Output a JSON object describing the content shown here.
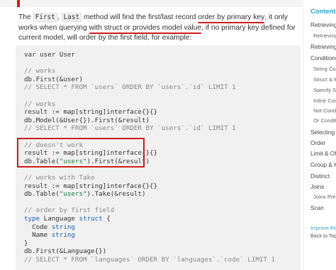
{
  "paragraph": {
    "intro": "The ",
    "code1": "First",
    "sep": ", ",
    "code2": "Last",
    "t1": " method will find the first/last record ",
    "u1": "order by primary key",
    "t2": ", it only works when querying ",
    "u2": "with struct or provides model value",
    "t3": ", if no primary key defined for current model, will order by the first field, for example:"
  },
  "code_lines": [
    {
      "text": "var user User",
      "cls": ""
    },
    {
      "text": "",
      "cls": ""
    },
    {
      "text": "// works",
      "cls": "c"
    },
    {
      "text": "db.First(&user)",
      "cls": ""
    },
    {
      "text": "// SELECT * FROM `users` ORDER BY `users`.`id` LIMIT 1",
      "cls": "c"
    },
    {
      "text": "",
      "cls": ""
    },
    {
      "text": "// works",
      "cls": "c"
    },
    {
      "text": "result := map[string]interface{}{}",
      "cls": ""
    },
    {
      "text": "db.Model(&User{}).First(&result)",
      "cls": ""
    },
    {
      "text": "// SELECT * FROM `users` ORDER BY `users`.`id` LIMIT 1",
      "cls": "c"
    },
    {
      "text": "",
      "cls": ""
    },
    {
      "text": "// doesn't work",
      "cls": "c"
    },
    {
      "text": "result := map[string]interface{}{}",
      "cls": ""
    },
    {
      "text": "db.Table(\"users\").First(&result)",
      "cls": "tbl"
    },
    {
      "text": "",
      "cls": ""
    },
    {
      "text": "// works with Take",
      "cls": "c"
    },
    {
      "text": "result := map[string]interface{}{}",
      "cls": ""
    },
    {
      "text": "db.Table(\"users\").Take(&result)",
      "cls": "tbl"
    },
    {
      "text": "",
      "cls": ""
    },
    {
      "text": "// order by first field",
      "cls": "c"
    },
    {
      "text": "type Language struct {",
      "cls": "type"
    },
    {
      "text": "  Code string",
      "cls": "field"
    },
    {
      "text": "  Name string",
      "cls": "field"
    },
    {
      "text": "}",
      "cls": ""
    },
    {
      "text": "db.First(&Language{})",
      "cls": ""
    },
    {
      "text": "// SELECT * FROM `languages` ORDER BY `languages`.`code` LIMIT 1",
      "cls": "c"
    }
  ],
  "sidebar": {
    "header": "Contents",
    "items": [
      {
        "label": "Retrieving",
        "sub": false
      },
      {
        "label": "Retrieving",
        "sub": true
      },
      {
        "label": "Retrieving",
        "sub": false
      },
      {
        "label": "Conditions",
        "sub": false
      },
      {
        "label": "String Co",
        "sub": true
      },
      {
        "label": "Struct & M",
        "sub": true
      },
      {
        "label": "Specify St",
        "sub": true
      },
      {
        "label": "Inline Cond",
        "sub": true
      },
      {
        "label": "Not Condi",
        "sub": true
      },
      {
        "label": "Or Conditi",
        "sub": true
      },
      {
        "label": "Selecting",
        "sub": false
      },
      {
        "label": "Order",
        "sub": false
      },
      {
        "label": "Limit & Of",
        "sub": false
      },
      {
        "label": "Group & H",
        "sub": false
      },
      {
        "label": "Distinct",
        "sub": false
      },
      {
        "label": "Joins",
        "sub": false
      },
      {
        "label": "Joins Prel",
        "sub": true
      },
      {
        "label": "Scan",
        "sub": false
      }
    ],
    "improve": "Improve this",
    "back_to_top": "Back to Top"
  }
}
